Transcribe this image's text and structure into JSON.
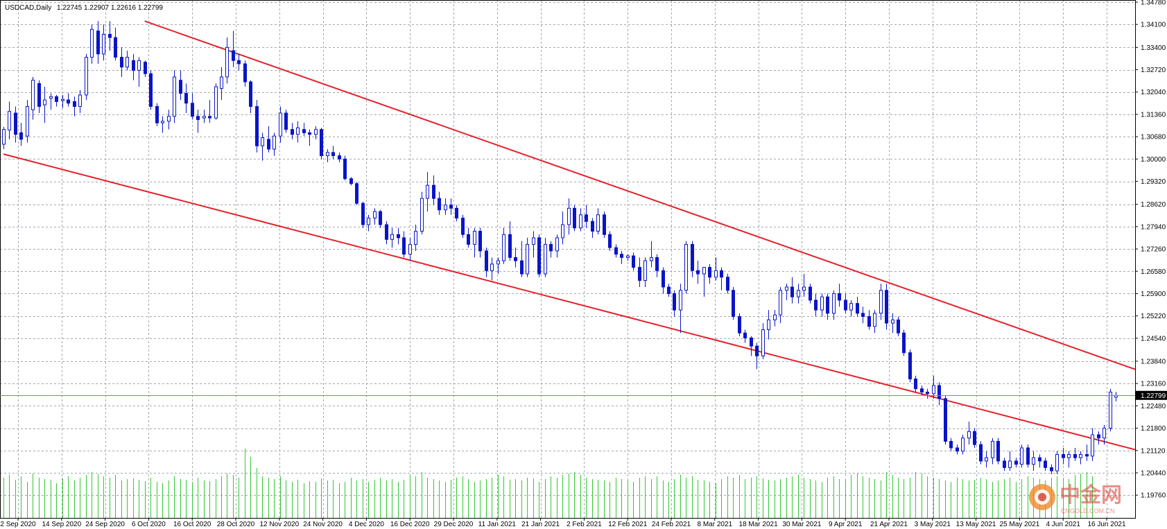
{
  "chart_title": "USDCAD,Daily",
  "ohlc_readout": "1.22745 1.22907 1.22616 1.22799",
  "current_price_label": "1.22799",
  "watermark": {
    "text": "中金网",
    "sub": "CNGOLD.COM.CN"
  },
  "colors": {
    "grid": "#a0a8b0",
    "candle": "#0a14c8",
    "volume": "#32c832",
    "trendline": "#e6202a",
    "price_line": "#6a8ab8",
    "current_tag": "#000000"
  },
  "chart_data": {
    "type": "candlestick",
    "symbol": "USDCAD",
    "timeframe": "Daily",
    "ylim": [
      1.1932,
      1.3478
    ],
    "y_ticks": [
      "1.34780",
      "1.34100",
      "1.33400",
      "1.32720",
      "1.32040",
      "1.31360",
      "1.30680",
      "1.30000",
      "1.29320",
      "1.28620",
      "1.27940",
      "1.27260",
      "1.26580",
      "1.25900",
      "1.25220",
      "1.24540",
      "1.23840",
      "1.23160",
      "1.22480",
      "1.21800",
      "1.21120",
      "1.20440",
      "1.19760"
    ],
    "x_ticks": [
      "2 Sep 2020",
      "14 Sep 2020",
      "24 Sep 2020",
      "6 Oct 2020",
      "16 Oct 2020",
      "28 Oct 2020",
      "12 Nov 2020",
      "24 Nov 2020",
      "4 Dec 2020",
      "16 Dec 2020",
      "29 Dec 2020",
      "11 Jan 2021",
      "21 Jan 2021",
      "2 Feb 2021",
      "12 Feb 2021",
      "24 Feb 2021",
      "8 Mar 2021",
      "18 Mar 2021",
      "30 Mar 2021",
      "9 Apr 2021",
      "21 Apr 2021",
      "3 May 2021",
      "13 May 2021",
      "25 May 2021",
      "4 Jun 2021",
      "16 Jun 2021"
    ],
    "current_price": 1.22799,
    "candles": [
      [
        1.3045,
        1.3098,
        1.303,
        1.309
      ],
      [
        1.3088,
        1.3175,
        1.306,
        1.3145
      ],
      [
        1.314,
        1.316,
        1.305,
        1.3075
      ],
      [
        1.308,
        1.311,
        1.304,
        1.306
      ],
      [
        1.307,
        1.318,
        1.305,
        1.316
      ],
      [
        1.315,
        1.325,
        1.312,
        1.324
      ],
      [
        1.323,
        1.324,
        1.314,
        1.316
      ],
      [
        1.3165,
        1.322,
        1.311,
        1.318
      ],
      [
        1.3185,
        1.32,
        1.315,
        1.319
      ],
      [
        1.319,
        1.3195,
        1.316,
        1.3175
      ],
      [
        1.3178,
        1.3195,
        1.3155,
        1.3182
      ],
      [
        1.318,
        1.32,
        1.316,
        1.317
      ],
      [
        1.3175,
        1.319,
        1.313,
        1.316
      ],
      [
        1.316,
        1.321,
        1.314,
        1.3195
      ],
      [
        1.3195,
        1.332,
        1.318,
        1.331
      ],
      [
        1.331,
        1.341,
        1.329,
        1.3395
      ],
      [
        1.339,
        1.342,
        1.329,
        1.332
      ],
      [
        1.332,
        1.341,
        1.33,
        1.338
      ],
      [
        1.338,
        1.342,
        1.333,
        1.337
      ],
      [
        1.337,
        1.34,
        1.33,
        1.331
      ],
      [
        1.331,
        1.334,
        1.325,
        1.328
      ],
      [
        1.328,
        1.333,
        1.327,
        1.331
      ],
      [
        1.33,
        1.332,
        1.324,
        1.327
      ],
      [
        1.327,
        1.331,
        1.322,
        1.33
      ],
      [
        1.3295,
        1.33,
        1.325,
        1.326
      ],
      [
        1.326,
        1.327,
        1.315,
        1.316
      ],
      [
        1.316,
        1.317,
        1.31,
        1.311
      ],
      [
        1.311,
        1.313,
        1.308,
        1.3115
      ],
      [
        1.3115,
        1.315,
        1.309,
        1.313
      ],
      [
        1.313,
        1.327,
        1.311,
        1.325
      ],
      [
        1.324,
        1.327,
        1.318,
        1.32
      ],
      [
        1.32,
        1.323,
        1.314,
        1.317
      ],
      [
        1.317,
        1.32,
        1.312,
        1.313
      ],
      [
        1.313,
        1.315,
        1.308,
        1.312
      ],
      [
        1.3125,
        1.315,
        1.311,
        1.313
      ],
      [
        1.313,
        1.318,
        1.311,
        1.3125
      ],
      [
        1.3125,
        1.323,
        1.312,
        1.322
      ],
      [
        1.3215,
        1.328,
        1.318,
        1.325
      ],
      [
        1.325,
        1.337,
        1.323,
        1.334
      ],
      [
        1.333,
        1.339,
        1.328,
        1.33
      ],
      [
        1.33,
        1.332,
        1.327,
        1.329
      ],
      [
        1.329,
        1.33,
        1.322,
        1.3235
      ],
      [
        1.3235,
        1.324,
        1.314,
        1.316
      ],
      [
        1.316,
        1.318,
        1.302,
        1.304
      ],
      [
        1.304,
        1.308,
        1.2995,
        1.3065
      ],
      [
        1.306,
        1.31,
        1.302,
        1.303
      ],
      [
        1.303,
        1.308,
        1.301,
        1.307
      ],
      [
        1.307,
        1.316,
        1.305,
        1.314
      ],
      [
        1.314,
        1.315,
        1.308,
        1.309
      ],
      [
        1.309,
        1.311,
        1.306,
        1.3075
      ],
      [
        1.3075,
        1.3115,
        1.305,
        1.3095
      ],
      [
        1.309,
        1.311,
        1.307,
        1.308
      ],
      [
        1.308,
        1.309,
        1.304,
        1.3075
      ],
      [
        1.3075,
        1.31,
        1.306,
        1.309
      ],
      [
        1.309,
        1.3095,
        1.3,
        1.301
      ],
      [
        1.301,
        1.303,
        1.299,
        1.302
      ],
      [
        1.302,
        1.304,
        1.3,
        1.301
      ],
      [
        1.301,
        1.302,
        1.299,
        1.3
      ],
      [
        1.3,
        1.301,
        1.2935,
        1.294
      ],
      [
        1.294,
        1.2945,
        1.292,
        1.2925
      ],
      [
        1.2925,
        1.293,
        1.286,
        1.2865
      ],
      [
        1.2865,
        1.287,
        1.279,
        1.28
      ],
      [
        1.28,
        1.283,
        1.278,
        1.282
      ],
      [
        1.282,
        1.285,
        1.28,
        1.284
      ],
      [
        1.284,
        1.2845,
        1.279,
        1.28
      ],
      [
        1.28,
        1.281,
        1.274,
        1.2755
      ],
      [
        1.2755,
        1.279,
        1.273,
        1.277
      ],
      [
        1.277,
        1.279,
        1.274,
        1.276
      ],
      [
        1.276,
        1.278,
        1.27,
        1.271
      ],
      [
        1.271,
        1.276,
        1.269,
        1.274
      ],
      [
        1.274,
        1.28,
        1.272,
        1.278
      ],
      [
        1.278,
        1.29,
        1.277,
        1.288
      ],
      [
        1.288,
        1.296,
        1.284,
        1.292
      ],
      [
        1.292,
        1.295,
        1.286,
        1.288
      ],
      [
        1.288,
        1.29,
        1.283,
        1.2845
      ],
      [
        1.2845,
        1.288,
        1.283,
        1.286
      ],
      [
        1.286,
        1.288,
        1.283,
        1.285
      ],
      [
        1.285,
        1.286,
        1.281,
        1.282
      ],
      [
        1.282,
        1.283,
        1.276,
        1.277
      ],
      [
        1.277,
        1.279,
        1.273,
        1.274
      ],
      [
        1.274,
        1.279,
        1.27,
        1.278
      ],
      [
        1.278,
        1.279,
        1.27,
        1.272
      ],
      [
        1.272,
        1.273,
        1.264,
        1.266
      ],
      [
        1.266,
        1.27,
        1.263,
        1.268
      ],
      [
        1.268,
        1.27,
        1.265,
        1.269
      ],
      [
        1.269,
        1.279,
        1.268,
        1.277
      ],
      [
        1.277,
        1.281,
        1.269,
        1.27
      ],
      [
        1.27,
        1.273,
        1.267,
        1.269
      ],
      [
        1.269,
        1.275,
        1.264,
        1.265
      ],
      [
        1.265,
        1.276,
        1.264,
        1.274
      ],
      [
        1.274,
        1.278,
        1.27,
        1.276
      ],
      [
        1.276,
        1.277,
        1.264,
        1.265
      ],
      [
        1.265,
        1.276,
        1.264,
        1.274
      ],
      [
        1.274,
        1.275,
        1.27,
        1.272
      ],
      [
        1.272,
        1.277,
        1.27,
        1.276
      ],
      [
        1.276,
        1.284,
        1.274,
        1.28
      ],
      [
        1.28,
        1.288,
        1.277,
        1.285
      ],
      [
        1.285,
        1.286,
        1.278,
        1.279
      ],
      [
        1.279,
        1.285,
        1.278,
        1.283
      ],
      [
        1.283,
        1.286,
        1.279,
        1.281
      ],
      [
        1.281,
        1.282,
        1.276,
        1.278
      ],
      [
        1.278,
        1.285,
        1.277,
        1.283
      ],
      [
        1.283,
        1.284,
        1.276,
        1.277
      ],
      [
        1.277,
        1.278,
        1.272,
        1.273
      ],
      [
        1.273,
        1.274,
        1.27,
        1.271
      ],
      [
        1.271,
        1.272,
        1.268,
        1.27
      ],
      [
        1.27,
        1.271,
        1.269,
        1.2705
      ],
      [
        1.2705,
        1.2715,
        1.266,
        1.267
      ],
      [
        1.267,
        1.27,
        1.261,
        1.263
      ],
      [
        1.263,
        1.27,
        1.261,
        1.269
      ],
      [
        1.269,
        1.275,
        1.267,
        1.27
      ],
      [
        1.27,
        1.271,
        1.264,
        1.266
      ],
      [
        1.266,
        1.267,
        1.259,
        1.261
      ],
      [
        1.261,
        1.262,
        1.258,
        1.259
      ],
      [
        1.259,
        1.26,
        1.252,
        1.254
      ],
      [
        1.254,
        1.262,
        1.247,
        1.26
      ],
      [
        1.26,
        1.275,
        1.259,
        1.274
      ],
      [
        1.274,
        1.275,
        1.264,
        1.266
      ],
      [
        1.266,
        1.269,
        1.262,
        1.265
      ],
      [
        1.265,
        1.267,
        1.258,
        1.267
      ],
      [
        1.267,
        1.268,
        1.262,
        1.264
      ],
      [
        1.264,
        1.27,
        1.263,
        1.266
      ],
      [
        1.266,
        1.267,
        1.26,
        1.264
      ],
      [
        1.264,
        1.265,
        1.259,
        1.26
      ],
      [
        1.26,
        1.261,
        1.251,
        1.252
      ],
      [
        1.252,
        1.253,
        1.246,
        1.247
      ],
      [
        1.247,
        1.248,
        1.244,
        1.2455
      ],
      [
        1.2455,
        1.246,
        1.24,
        1.243
      ],
      [
        1.243,
        1.244,
        1.236,
        1.24
      ],
      [
        1.24,
        1.25,
        1.239,
        1.248
      ],
      [
        1.248,
        1.254,
        1.245,
        1.251
      ],
      [
        1.251,
        1.254,
        1.249,
        1.2525
      ],
      [
        1.2525,
        1.261,
        1.25,
        1.26
      ],
      [
        1.26,
        1.262,
        1.257,
        1.261
      ],
      [
        1.261,
        1.264,
        1.256,
        1.258
      ],
      [
        1.258,
        1.262,
        1.256,
        1.26
      ],
      [
        1.26,
        1.265,
        1.258,
        1.261
      ],
      [
        1.261,
        1.262,
        1.256,
        1.257
      ],
      [
        1.257,
        1.259,
        1.252,
        1.254
      ],
      [
        1.254,
        1.259,
        1.252,
        1.258
      ],
      [
        1.258,
        1.259,
        1.251,
        1.253
      ],
      [
        1.253,
        1.26,
        1.251,
        1.259
      ],
      [
        1.259,
        1.262,
        1.255,
        1.257
      ],
      [
        1.257,
        1.259,
        1.253,
        1.254
      ],
      [
        1.254,
        1.257,
        1.252,
        1.256
      ],
      [
        1.256,
        1.258,
        1.252,
        1.253
      ],
      [
        1.253,
        1.255,
        1.25,
        1.252
      ],
      [
        1.252,
        1.254,
        1.248,
        1.249
      ],
      [
        1.249,
        1.254,
        1.247,
        1.253
      ],
      [
        1.253,
        1.262,
        1.251,
        1.26
      ],
      [
        1.26,
        1.262,
        1.248,
        1.25
      ],
      [
        1.25,
        1.253,
        1.247,
        1.251
      ],
      [
        1.251,
        1.252,
        1.246,
        1.247
      ],
      [
        1.247,
        1.248,
        1.24,
        1.241
      ],
      [
        1.241,
        1.242,
        1.232,
        1.233
      ],
      [
        1.233,
        1.234,
        1.229,
        1.23
      ],
      [
        1.23,
        1.231,
        1.228,
        1.229
      ],
      [
        1.229,
        1.23,
        1.227,
        1.2285
      ],
      [
        1.2285,
        1.234,
        1.227,
        1.231
      ],
      [
        1.231,
        1.232,
        1.225,
        1.227
      ],
      [
        1.227,
        1.228,
        1.213,
        1.214
      ],
      [
        1.214,
        1.215,
        1.211,
        1.212
      ],
      [
        1.212,
        1.213,
        1.21,
        1.211
      ],
      [
        1.211,
        1.216,
        1.21,
        1.215
      ],
      [
        1.215,
        1.22,
        1.213,
        1.217
      ],
      [
        1.217,
        1.218,
        1.212,
        1.213
      ],
      [
        1.213,
        1.214,
        1.207,
        1.208
      ],
      [
        1.208,
        1.211,
        1.206,
        1.209
      ],
      [
        1.209,
        1.215,
        1.207,
        1.214
      ],
      [
        1.214,
        1.215,
        1.207,
        1.208
      ],
      [
        1.208,
        1.209,
        1.205,
        1.206
      ],
      [
        1.206,
        1.211,
        1.205,
        1.208
      ],
      [
        1.208,
        1.209,
        1.206,
        1.207
      ],
      [
        1.207,
        1.213,
        1.206,
        1.212
      ],
      [
        1.212,
        1.213,
        1.206,
        1.207
      ],
      [
        1.207,
        1.211,
        1.205,
        1.209
      ],
      [
        1.209,
        1.21,
        1.206,
        1.208
      ],
      [
        1.208,
        1.209,
        1.205,
        1.206
      ],
      [
        1.206,
        1.207,
        1.204,
        1.205
      ],
      [
        1.205,
        1.211,
        1.204,
        1.21
      ],
      [
        1.21,
        1.212,
        1.207,
        1.209
      ],
      [
        1.209,
        1.211,
        1.206,
        1.21
      ],
      [
        1.21,
        1.212,
        1.208,
        1.209
      ],
      [
        1.209,
        1.211,
        1.207,
        1.21
      ],
      [
        1.21,
        1.213,
        1.208,
        1.2095
      ],
      [
        1.2095,
        1.218,
        1.208,
        1.216
      ],
      [
        1.216,
        1.217,
        1.213,
        1.215
      ],
      [
        1.215,
        1.219,
        1.213,
        1.218
      ],
      [
        1.218,
        1.23,
        1.217,
        1.229
      ],
      [
        1.22745,
        1.22907,
        1.22616,
        1.22799
      ]
    ],
    "volumes": [
      58,
      62,
      55,
      60,
      52,
      64,
      58,
      56,
      55,
      50,
      57,
      60,
      54,
      58,
      62,
      66,
      63,
      60,
      58,
      62,
      54,
      56,
      57,
      55,
      53,
      58,
      52,
      50,
      54,
      60,
      56,
      55,
      52,
      58,
      54,
      53,
      56,
      60,
      64,
      62,
      58,
      100,
      88,
      72,
      60,
      58,
      56,
      60,
      54,
      52,
      55,
      50,
      53,
      52,
      57,
      54,
      55,
      50,
      52,
      58,
      54,
      56,
      52,
      55,
      58,
      54,
      56,
      52,
      55,
      62,
      60,
      66,
      58,
      56,
      54,
      52,
      55,
      58,
      60,
      56,
      52,
      54,
      56,
      58,
      62,
      60,
      55,
      56,
      54,
      58,
      57,
      52,
      56,
      60,
      58,
      62,
      64,
      66,
      62,
      58,
      56,
      55,
      54,
      52,
      58,
      56,
      54,
      52,
      58,
      60,
      56,
      60,
      54,
      52,
      56,
      62,
      58,
      60,
      55,
      54,
      52,
      50,
      56,
      60,
      58,
      62,
      56,
      58,
      60,
      57,
      55,
      54,
      56,
      58,
      60,
      62,
      58,
      56,
      54,
      52,
      58,
      60,
      56,
      55,
      62,
      64,
      60,
      58,
      56,
      54,
      66,
      62,
      58,
      56,
      58,
      66,
      64,
      60,
      58,
      56,
      54,
      52,
      58,
      56,
      54,
      55,
      58,
      56,
      52,
      54,
      56,
      58,
      52,
      56,
      60,
      58,
      56,
      54,
      58,
      60,
      58,
      56,
      62,
      64,
      66,
      60
    ],
    "trendlines": [
      {
        "from_index": 24,
        "from_value": 1.342,
        "to_index": 189,
        "to_value": 1.238
      },
      {
        "from_index": 0,
        "from_value": 1.3015,
        "to_index": 189,
        "to_value": 1.213
      }
    ]
  }
}
